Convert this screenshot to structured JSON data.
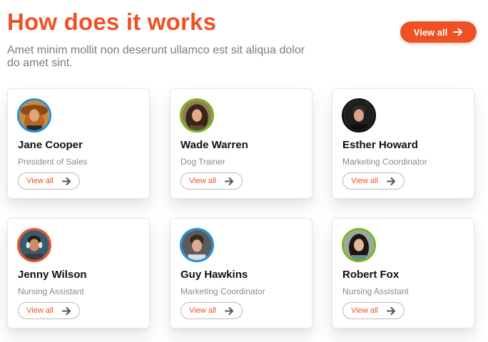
{
  "header": {
    "title": "How does it works",
    "subtitle": "Amet minim mollit non deserunt ullamco est sit aliqua dolor do amet sint.",
    "view_all_label": "View all"
  },
  "colors": {
    "accent": "#ef5124",
    "ring_blue": "#1f8fd8",
    "ring_green": "#7ab51d",
    "ring_black": "#111111",
    "ring_orange": "#ef5124"
  },
  "cards": [
    {
      "name": "Jane Cooper",
      "role": "President of Sales",
      "button_label": "View all",
      "ring": "blue"
    },
    {
      "name": "Wade Warren",
      "role": "Dog Trainer",
      "button_label": "View all",
      "ring": "green"
    },
    {
      "name": "Esther Howard",
      "role": "Marketing Coordinator",
      "button_label": "View all",
      "ring": "black"
    },
    {
      "name": "Jenny Wilson",
      "role": "Nursing Assistant",
      "button_label": "View all",
      "ring": "orange"
    },
    {
      "name": "Guy Hawkins",
      "role": "Marketing Coordinator",
      "button_label": "View all",
      "ring": "blue"
    },
    {
      "name": "Robert Fox",
      "role": "Nursing Assistant",
      "button_label": "View all",
      "ring": "green"
    }
  ]
}
